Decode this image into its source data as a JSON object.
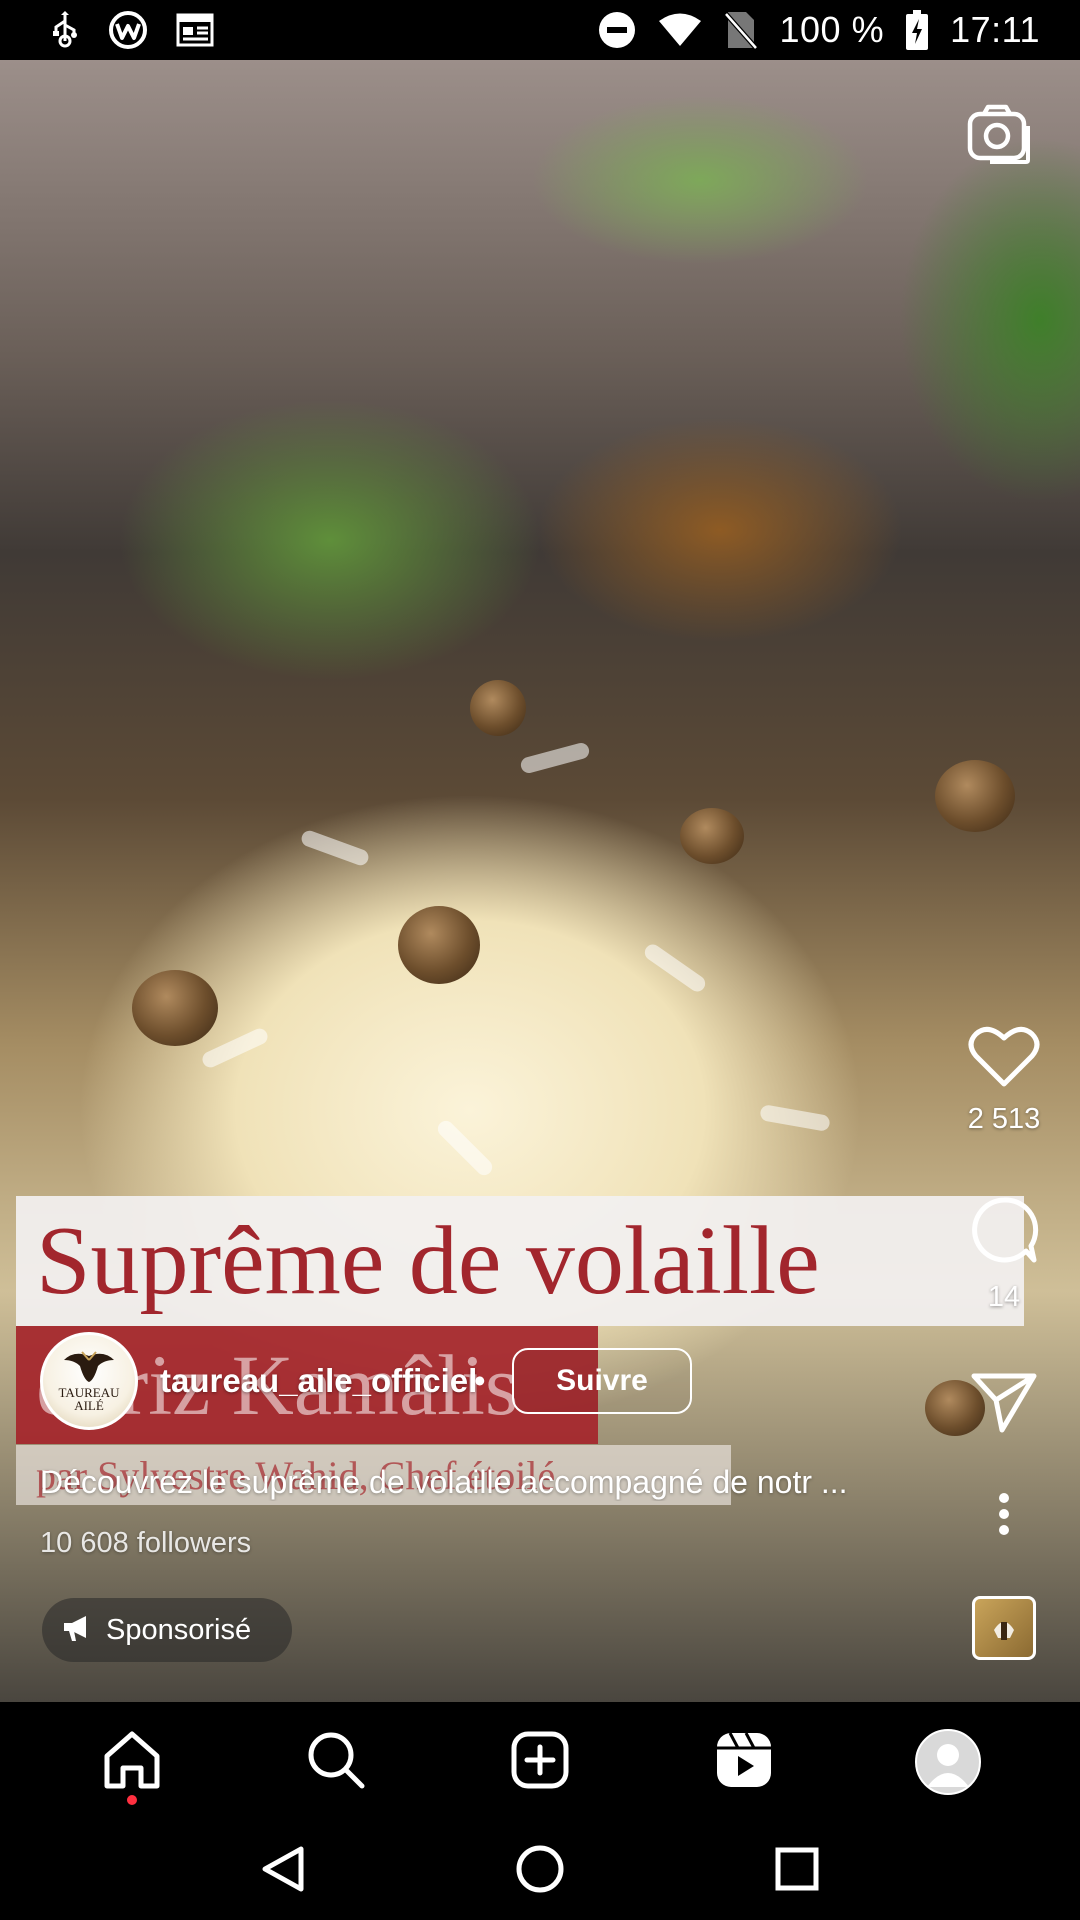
{
  "status_bar": {
    "battery_percent": "100 %",
    "time": "17:11",
    "left_icons": [
      "usb-icon",
      "vpn-icon",
      "news-icon"
    ],
    "right_icons": [
      "do-not-disturb-icon",
      "wifi-icon",
      "no-sim-icon",
      "battery-charging-icon"
    ]
  },
  "title_card": {
    "line1": "Suprême de volaille",
    "line2": "et riz Kamâlis",
    "line3": "par Sylvestre Wahid, Chef étoilé"
  },
  "actions": {
    "likes": "2 513",
    "comments": "14"
  },
  "post": {
    "avatar_logo_text": "TAUREAU AILÉ",
    "username": "taureau_aile_officiel",
    "separator": "•",
    "follow_label": "Suivre",
    "caption": "Découvrez le suprême de volaille accompagné de notr ...",
    "followers": "10 608 followers",
    "sponsored_label": "Sponsorisé"
  },
  "bottom_nav": {
    "items": [
      "home-icon",
      "search-icon",
      "create-post-icon",
      "reels-icon",
      "profile-avatar"
    ]
  },
  "colors": {
    "title_red": "#a2262d",
    "notification_dot": "#ff3040"
  }
}
